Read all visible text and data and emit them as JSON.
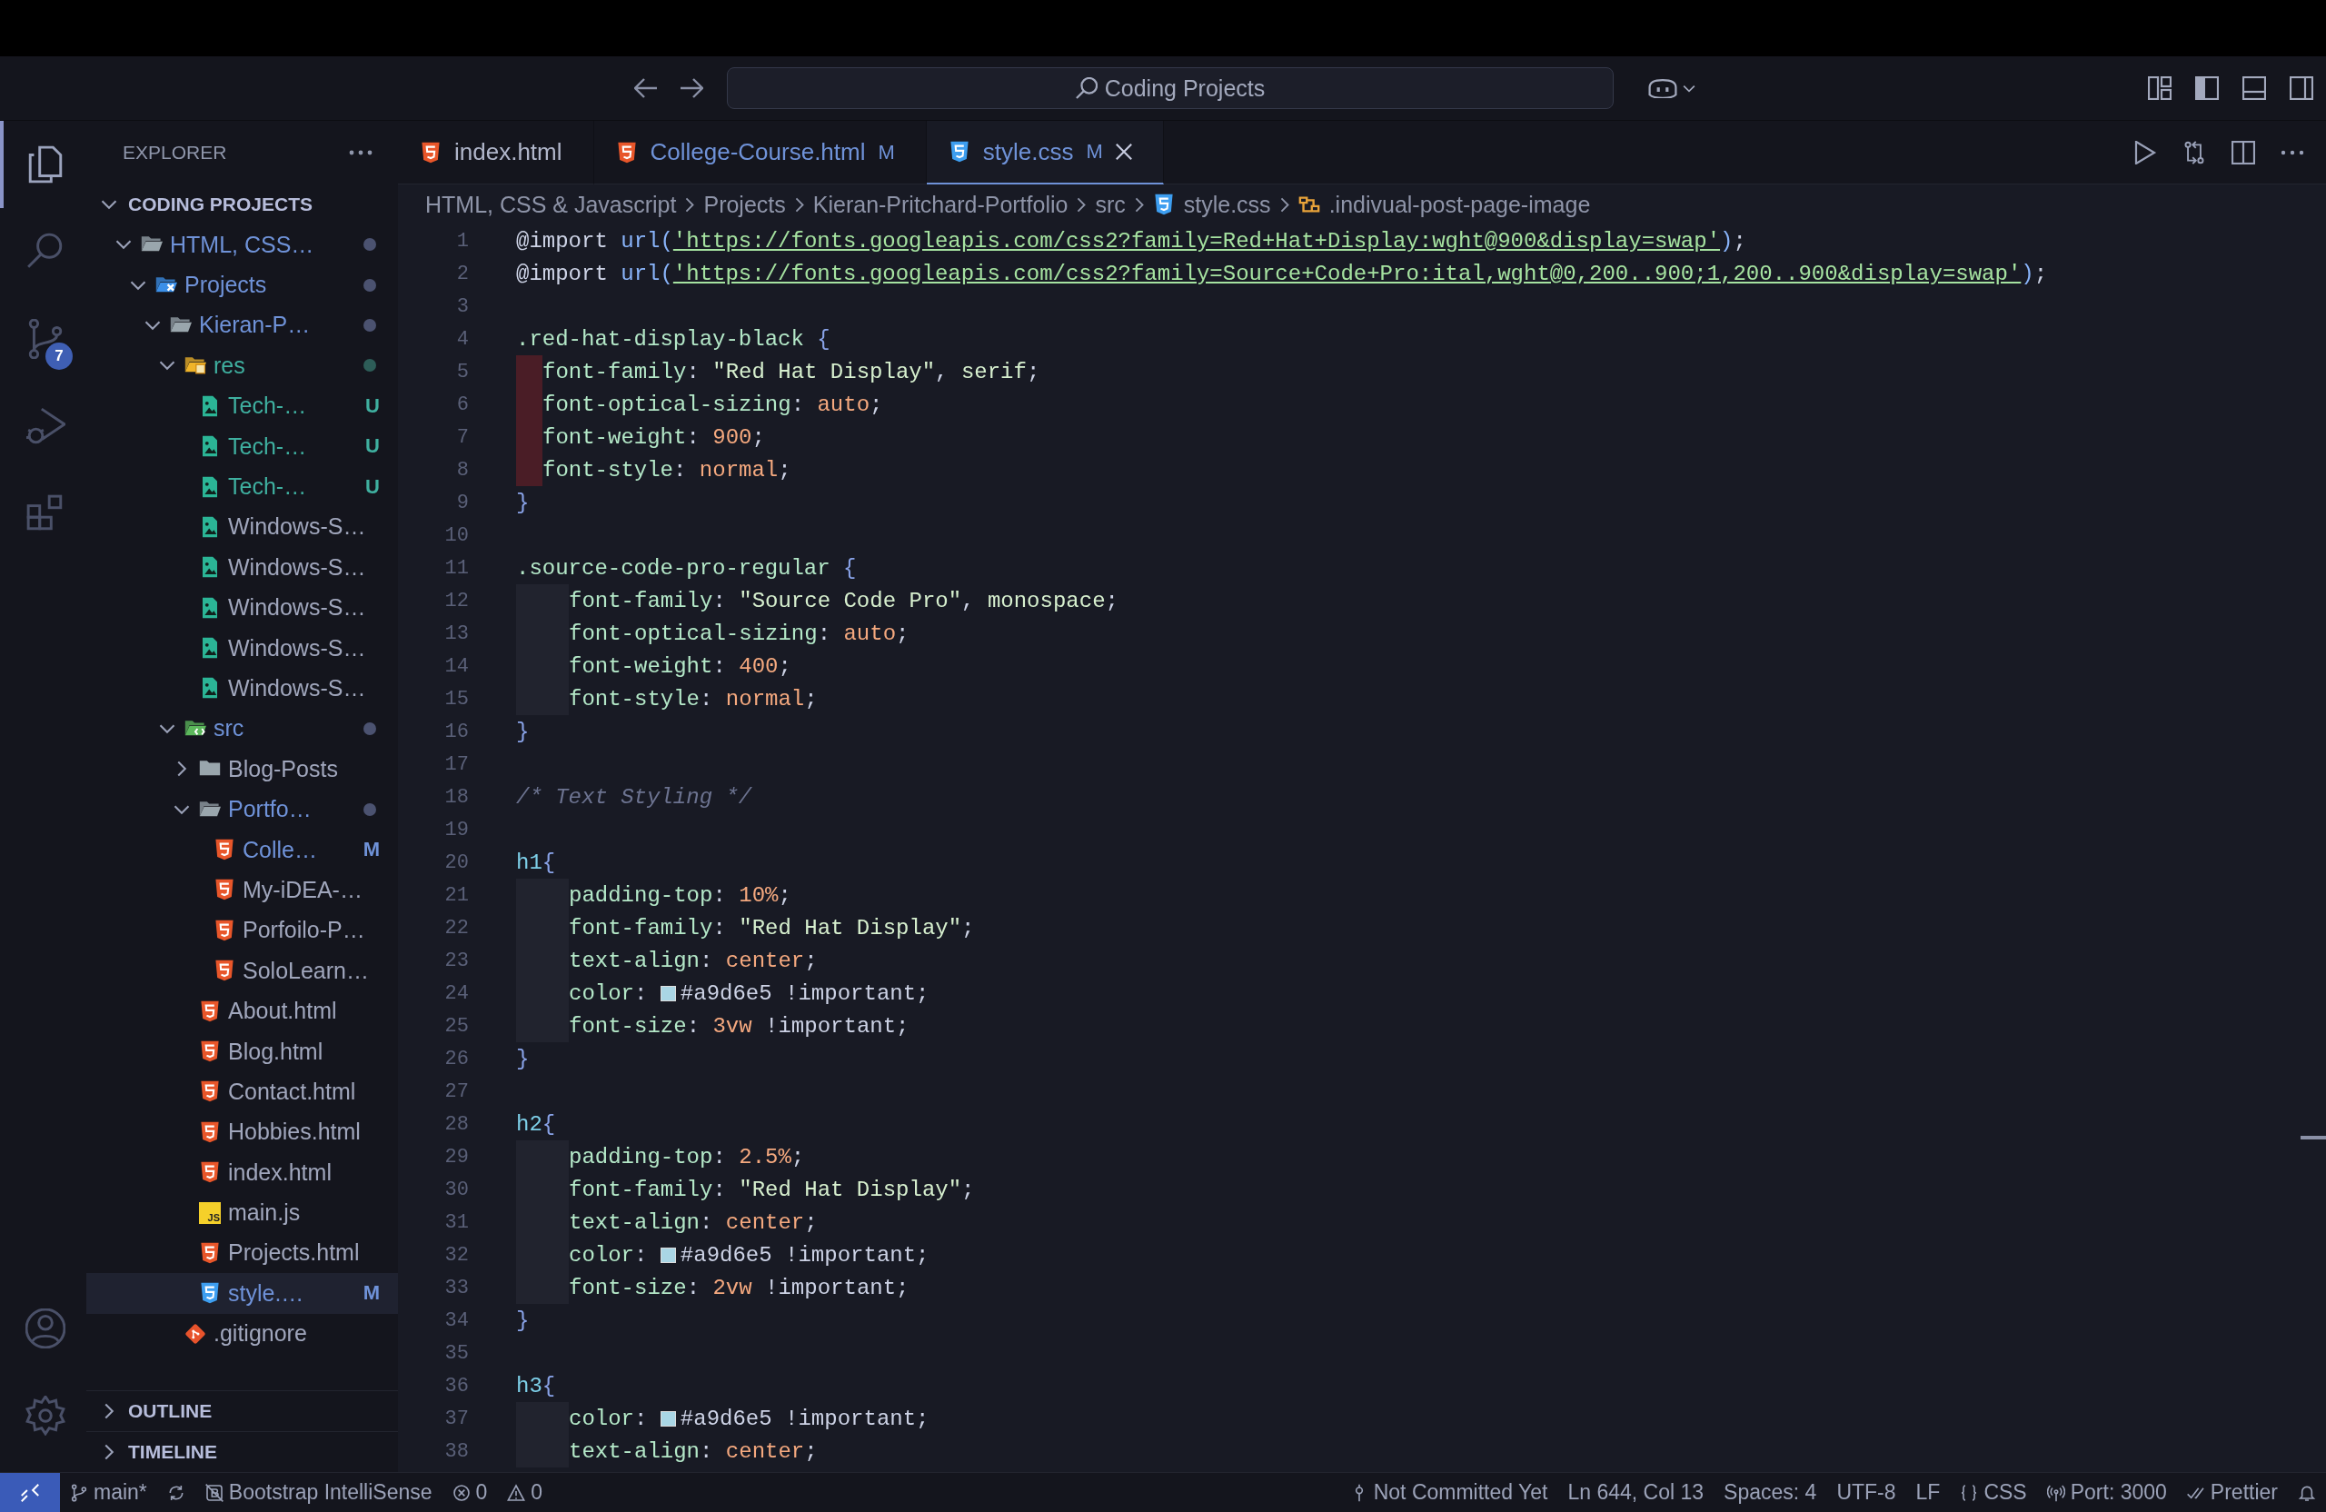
{
  "title_bar": {
    "search": {
      "value": "Coding Projects"
    }
  },
  "activity_bar": {
    "items": [
      {
        "kind": "explorer",
        "selected": true
      },
      {
        "kind": "search",
        "selected": false
      },
      {
        "kind": "source-control",
        "selected": false,
        "badge": "7"
      },
      {
        "kind": "run",
        "selected": false
      },
      {
        "kind": "extensions",
        "selected": false
      }
    ],
    "bottom": [
      {
        "kind": "account"
      },
      {
        "kind": "settings"
      }
    ]
  },
  "sidebar": {
    "title": "EXPLORER",
    "section": {
      "title": "CODING PROJECTS",
      "expanded": true
    },
    "tree": [
      {
        "name": "HTML, CSS…",
        "kind": "folder",
        "expanded": true,
        "modified": true,
        "untracked": false,
        "selected": false,
        "children": [
          {
            "name": "Projects",
            "kind": "folder-projects",
            "expanded": true,
            "modified": true,
            "untracked": false,
            "selected": false,
            "children": [
              {
                "name": "Kieran-P…",
                "kind": "folder",
                "expanded": true,
                "modified": true,
                "untracked": false,
                "selected": false,
                "children": [
                  {
                    "name": "res",
                    "kind": "folder-res",
                    "expanded": true,
                    "modified": false,
                    "untracked": true,
                    "selected": false,
                    "children": [
                      {
                        "name": "Tech-…",
                        "kind": "image",
                        "modified": false,
                        "untracked": true,
                        "badge": "U",
                        "selected": false
                      },
                      {
                        "name": "Tech-…",
                        "kind": "image",
                        "modified": false,
                        "untracked": true,
                        "badge": "U",
                        "selected": false
                      },
                      {
                        "name": "Tech-…",
                        "kind": "image",
                        "modified": false,
                        "untracked": true,
                        "badge": "U",
                        "selected": false
                      },
                      {
                        "name": "Windows-S…",
                        "kind": "image",
                        "modified": false,
                        "untracked": false,
                        "selected": false
                      },
                      {
                        "name": "Windows-S…",
                        "kind": "image",
                        "modified": false,
                        "untracked": false,
                        "selected": false
                      },
                      {
                        "name": "Windows-S…",
                        "kind": "image",
                        "modified": false,
                        "untracked": false,
                        "selected": false
                      },
                      {
                        "name": "Windows-S…",
                        "kind": "image",
                        "modified": false,
                        "untracked": false,
                        "selected": false
                      },
                      {
                        "name": "Windows-S…",
                        "kind": "image",
                        "modified": false,
                        "untracked": false,
                        "selected": false
                      }
                    ]
                  },
                  {
                    "name": "src",
                    "kind": "folder-src",
                    "expanded": true,
                    "modified": true,
                    "untracked": false,
                    "selected": false,
                    "children": [
                      {
                        "name": "Blog-Posts",
                        "kind": "folder",
                        "expanded": false,
                        "modified": false,
                        "untracked": false,
                        "selected": false
                      },
                      {
                        "name": "Portfo…",
                        "kind": "folder",
                        "expanded": true,
                        "modified": true,
                        "untracked": false,
                        "selected": false,
                        "children": [
                          {
                            "name": "Colle…",
                            "kind": "html",
                            "modified": true,
                            "untracked": false,
                            "badge": "M",
                            "selected": false
                          },
                          {
                            "name": "My-iDEA-…",
                            "kind": "html",
                            "modified": false,
                            "untracked": false,
                            "selected": false
                          },
                          {
                            "name": "Porfoilo-P…",
                            "kind": "html",
                            "modified": false,
                            "untracked": false,
                            "selected": false
                          },
                          {
                            "name": "SoloLearn…",
                            "kind": "html",
                            "modified": false,
                            "untracked": false,
                            "selected": false
                          }
                        ]
                      },
                      {
                        "name": "About.html",
                        "kind": "html",
                        "modified": false,
                        "untracked": false,
                        "selected": false
                      },
                      {
                        "name": "Blog.html",
                        "kind": "html",
                        "modified": false,
                        "untracked": false,
                        "selected": false
                      },
                      {
                        "name": "Contact.html",
                        "kind": "html",
                        "modified": false,
                        "untracked": false,
                        "selected": false
                      },
                      {
                        "name": "Hobbies.html",
                        "kind": "html",
                        "modified": false,
                        "untracked": false,
                        "selected": false
                      },
                      {
                        "name": "index.html",
                        "kind": "html",
                        "modified": false,
                        "untracked": false,
                        "selected": false
                      },
                      {
                        "name": "main.js",
                        "kind": "js",
                        "logo_text": "JS",
                        "modified": false,
                        "untracked": false,
                        "selected": false
                      },
                      {
                        "name": "Projects.html",
                        "kind": "html",
                        "modified": false,
                        "untracked": false,
                        "selected": false
                      },
                      {
                        "name": "style.…",
                        "kind": "css",
                        "modified": true,
                        "untracked": false,
                        "badge": "M",
                        "selected": true
                      }
                    ]
                  },
                  {
                    "name": ".gitignore",
                    "kind": "git",
                    "modified": false,
                    "untracked": false,
                    "selected": false
                  }
                ]
              }
            ]
          }
        ]
      }
    ],
    "panels": [
      {
        "title": "OUTLINE",
        "expanded": false
      },
      {
        "title": "TIMELINE",
        "expanded": false
      }
    ]
  },
  "tabs": [
    {
      "label": "index.html",
      "kind": "html",
      "modified": false,
      "selected": false
    },
    {
      "label": "College-Course.html",
      "kind": "html",
      "modified": true,
      "badge": "M",
      "selected": false
    },
    {
      "label": "style.css",
      "kind": "css",
      "modified": true,
      "badge": "M",
      "selected": true
    }
  ],
  "breadcrumbs": [
    {
      "label": "HTML, CSS & Javascript",
      "kind": "folder"
    },
    {
      "label": "Projects",
      "kind": "folder"
    },
    {
      "label": "Kieran-Pritchard-Portfolio",
      "kind": "folder"
    },
    {
      "label": "src",
      "kind": "folder"
    },
    {
      "label": "style.css",
      "kind": "css"
    },
    {
      "label": ".indivual-post-page-image",
      "kind": "symbol"
    }
  ],
  "editor": {
    "lines": [
      {
        "number": "1",
        "kind": "plain",
        "text": "@import url('https://fonts.googleapis.com/css2?family=Red+Hat+Display:wght@900&display=swap');"
      },
      {
        "number": "2",
        "kind": "plain",
        "text": "@import url('https://fonts.googleapis.com/css2?family=Source+Code+Pro:ital,wght@0,200..900;1,200..900&display=swap');"
      },
      {
        "number": "3",
        "kind": "plain"
      },
      {
        "number": "4",
        "kind": "plain",
        "text": ".red-hat-display-black {"
      },
      {
        "number": "5",
        "kind": "misindented",
        "text": "font-family: \"Red Hat Display\", serif;"
      },
      {
        "number": "6",
        "kind": "misindented",
        "text": "font-optical-sizing: auto;"
      },
      {
        "number": "7",
        "kind": "misindented",
        "text": "font-weight: 900;"
      },
      {
        "number": "8",
        "kind": "misindented",
        "text": "font-style: normal;"
      },
      {
        "number": "9",
        "kind": "plain",
        "text": "}"
      },
      {
        "number": "10",
        "kind": "plain"
      },
      {
        "number": "11",
        "kind": "plain",
        "text": ".source-code-pro-regular {"
      },
      {
        "number": "12",
        "kind": "indented",
        "text": "font-family: \"Source Code Pro\", monospace;"
      },
      {
        "number": "13",
        "kind": "indented",
        "text": "font-optical-sizing: auto;"
      },
      {
        "number": "14",
        "kind": "indented",
        "text": "font-weight: 400;"
      },
      {
        "number": "15",
        "kind": "indented",
        "text": "font-style: normal;"
      },
      {
        "number": "16",
        "kind": "plain",
        "text": "}"
      },
      {
        "number": "17",
        "kind": "plain"
      },
      {
        "number": "18",
        "kind": "plain",
        "text": "/* Text Styling */"
      },
      {
        "number": "19",
        "kind": "plain"
      },
      {
        "number": "20",
        "kind": "plain",
        "text": "h1{"
      },
      {
        "number": "21",
        "kind": "indented",
        "text": "padding-top: 10%;"
      },
      {
        "number": "22",
        "kind": "indented",
        "text": "font-family: \"Red Hat Display\";"
      },
      {
        "number": "23",
        "kind": "indented",
        "text": "text-align: center;"
      },
      {
        "number": "24",
        "kind": "indented",
        "text": "color: #a9d6e5 !important;"
      },
      {
        "number": "25",
        "kind": "indented",
        "text": "font-size: 3vw !important;"
      },
      {
        "number": "26",
        "kind": "plain",
        "text": "}"
      },
      {
        "number": "27",
        "kind": "plain"
      },
      {
        "number": "28",
        "kind": "plain",
        "text": "h2{"
      },
      {
        "number": "29",
        "kind": "indented",
        "text": "padding-top: 2.5%;"
      },
      {
        "number": "30",
        "kind": "indented",
        "text": "font-family: \"Red Hat Display\";"
      },
      {
        "number": "31",
        "kind": "indented",
        "text": "text-align: center;"
      },
      {
        "number": "32",
        "kind": "indented",
        "text": "color: #a9d6e5 !important;"
      },
      {
        "number": "33",
        "kind": "indented",
        "text": "font-size: 2vw !important;"
      },
      {
        "number": "34",
        "kind": "plain",
        "text": "}"
      },
      {
        "number": "35",
        "kind": "plain"
      },
      {
        "number": "36",
        "kind": "plain",
        "text": "h3{"
      },
      {
        "number": "37",
        "kind": "indented",
        "text": "color: #a9d6e5 !important;"
      },
      {
        "number": "38",
        "kind": "indented",
        "text": "text-align: center;"
      }
    ]
  },
  "status_bar": {
    "left": [
      {
        "kind": "branch",
        "text": "main*"
      },
      {
        "kind": "sync"
      },
      {
        "kind": "bootstrap",
        "text": "Bootstrap IntelliSense"
      },
      {
        "kind": "error",
        "text": "0"
      },
      {
        "kind": "warning",
        "text": "0"
      }
    ],
    "right": [
      {
        "kind": "commit",
        "text": "Not Committed Yet"
      },
      {
        "kind": "plain",
        "text": "Ln 644, Col 13"
      },
      {
        "kind": "plain",
        "text": "Spaces: 4"
      },
      {
        "kind": "plain",
        "text": "UTF-8"
      },
      {
        "kind": "plain",
        "text": "LF"
      },
      {
        "kind": "braces",
        "text": "CSS"
      },
      {
        "kind": "broadcast",
        "text": "Port: 3000"
      },
      {
        "kind": "check",
        "text": "Prettier"
      },
      {
        "kind": "bell"
      }
    ]
  }
}
